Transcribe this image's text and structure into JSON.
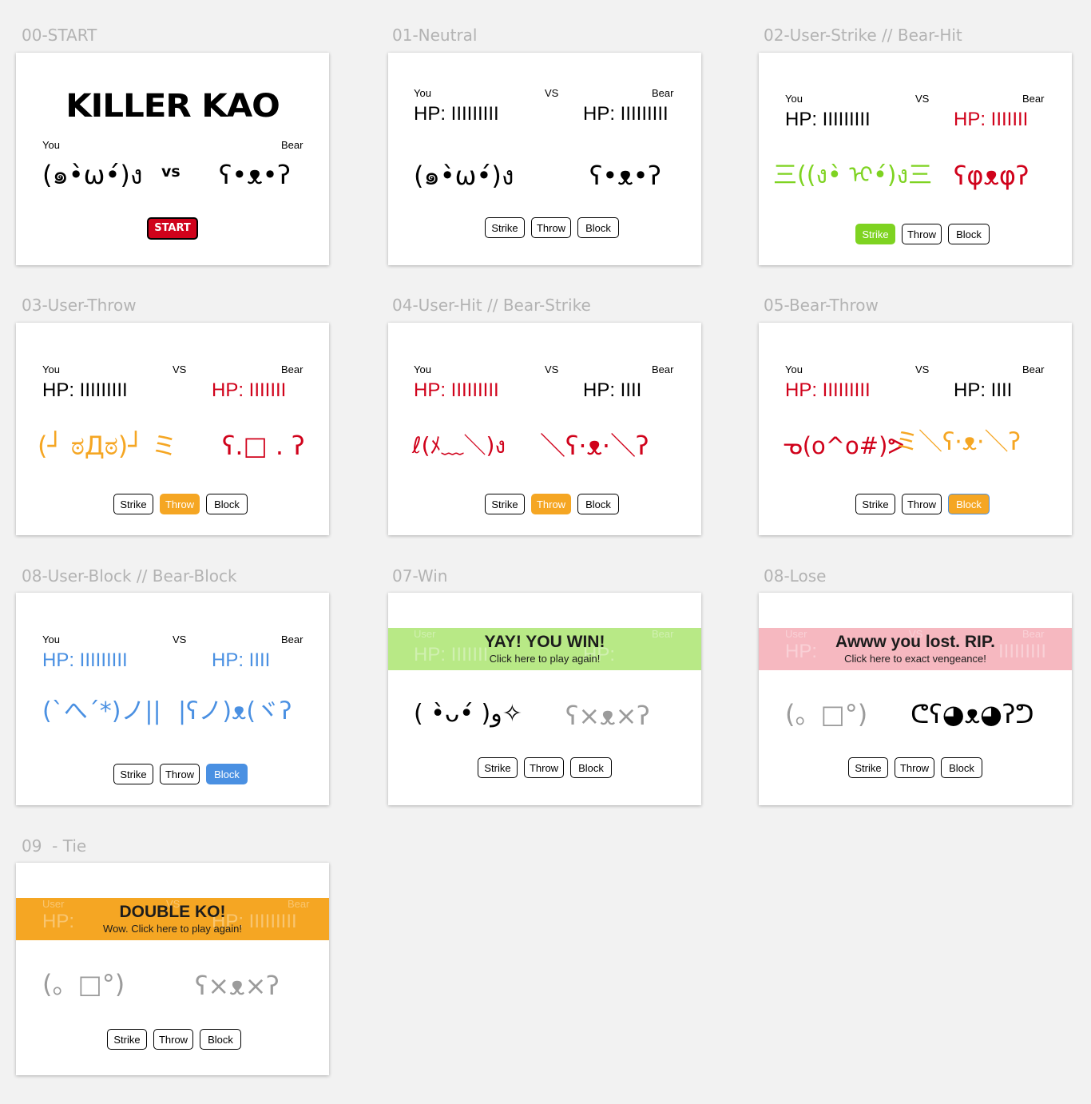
{
  "frames": [
    {
      "title": "00-START",
      "game_title": "KILLER KAO",
      "you_label": "You",
      "bear_label": "Bear",
      "vs": "vs",
      "user_face": "(๑•̀ω•́)ง",
      "bear_face": "ʕ•ᴥ•ʔ",
      "start_label": "START",
      "start_color": "#d0021b"
    },
    {
      "title": "01-Neutral",
      "you_label": "You",
      "vs": "VS",
      "bear_label": "Bear",
      "user_hp": "HP: IIIIIIIII",
      "bear_hp": "HP: IIIIIIIII",
      "user_face": "(๑•̀ω•́)ง",
      "bear_face": "ʕ•ᴥ•ʔ",
      "buttons": [
        "Strike",
        "Throw",
        "Block"
      ],
      "active": null
    },
    {
      "title": "02-User-Strike // Bear-Hit",
      "you_label": "You",
      "vs": "VS",
      "bear_label": "Bear",
      "user_hp": "HP: IIIIIIIII",
      "bear_hp": "HP: IIIIIII",
      "user_face": "三((ง•̀ ᢈ•́)ง三",
      "bear_face": "ʕφᴥφʔ",
      "buttons": [
        "Strike",
        "Throw",
        "Block"
      ],
      "active": "Strike",
      "color": "#7ed321",
      "bear_hp_color": "#d0021b"
    },
    {
      "title": "03-User-Throw",
      "you_label": "You",
      "vs": "VS",
      "bear_label": "Bear",
      "user_hp": "HP: IIIIIIIII",
      "bear_hp": "HP: IIIIIII",
      "user_face": "(┘ ಠДಠ)┘ ミ",
      "bear_face": "ʕ.□ . ʔ",
      "buttons": [
        "Strike",
        "Throw",
        "Block"
      ],
      "active": "Throw",
      "color": "#f5a623",
      "bear_hp_color": "#d0021b"
    },
    {
      "title": "04-User-Hit // Bear-Strike",
      "you_label": "You",
      "vs": "VS",
      "bear_label": "Bear",
      "user_hp": "HP: IIIIIIIII",
      "bear_hp": "HP: IIII",
      "user_face": "ℓ(ﾒ﹏＼)ง",
      "bear_face": "＼ʕ·ᴥ·＼ʔ",
      "buttons": [
        "Strike",
        "Throw",
        "Block"
      ],
      "active": "Throw",
      "color": "#d0021b"
    },
    {
      "title": "05-Bear-Throw",
      "you_label": "You",
      "vs": "VS",
      "bear_label": "Bear",
      "user_hp": "HP: IIIIIIIII",
      "bear_hp": "HP: IIII",
      "user_face": "ᓀ(o^o#)ᕗ",
      "bear_face": "ミ＼ʕ·ᴥ·＼ʔ",
      "buttons": [
        "Strike",
        "Throw",
        "Block"
      ],
      "active": "Block",
      "user_color": "#d0021b",
      "bear_color": "#f5a623"
    },
    {
      "title": "08-User-Block // Bear-Block",
      "you_label": "You",
      "vs": "VS",
      "bear_label": "Bear",
      "user_hp": "HP: IIIIIIIII",
      "bear_hp": "HP: IIII",
      "user_face": "(`へ´*)ノ||",
      "bear_face": "|ʕノ)ᴥ(ヾʔ",
      "buttons": [
        "Strike",
        "Throw",
        "Block"
      ],
      "active": "Block",
      "color": "#4a90e2"
    },
    {
      "title": "07-Win",
      "banner_title": "YAY! YOU WIN!",
      "banner_sub": "Click here to play again!",
      "banner_color": "#b8e986",
      "ghost_user": "User",
      "ghost_bear": "Bear",
      "ghost_hp": "HP: IIIIIII",
      "ghost_hp_right": "HP:",
      "user_face": "( •̀ᴗ•́ )و✧",
      "bear_face": "ʕ×ᴥ×ʔ",
      "buttons": [
        "Strike",
        "Throw",
        "Block"
      ]
    },
    {
      "title": "08-Lose",
      "banner_title": "Awww you lost. RIP.",
      "banner_sub": "Click here to exact vengeance!",
      "banner_color": "#f6b8c0",
      "ghost_user": "User",
      "ghost_vs": "VS",
      "ghost_bear": "Bear",
      "ghost_hp": "HP:",
      "ghost_hp_right": "IIIIIIIII",
      "user_face": "(。□°)",
      "bear_face": "ᕦʕ◕ᴥ◕ʔᕤ",
      "buttons": [
        "Strike",
        "Throw",
        "Block"
      ]
    },
    {
      "title": "09  - Tie",
      "banner_title": "DOUBLE KO!",
      "banner_sub": "Wow. Click here to play again!",
      "banner_color": "#f5a623",
      "ghost_user": "User",
      "ghost_vs": "VS",
      "ghost_bear": "Bear",
      "ghost_hp": "HP:",
      "ghost_hp_right": "HP: IIIIIIIII",
      "user_face": "(。□°)",
      "bear_face": "ʕ×ᴥ×ʔ",
      "buttons": [
        "Strike",
        "Throw",
        "Block"
      ]
    }
  ]
}
